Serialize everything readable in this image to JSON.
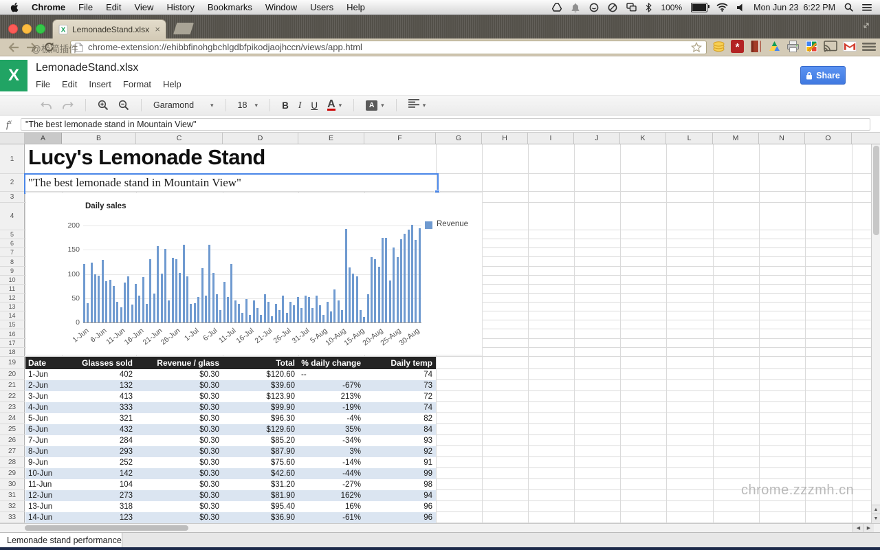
{
  "macbar": {
    "menus": [
      "Chrome",
      "File",
      "Edit",
      "View",
      "History",
      "Bookmarks",
      "Window",
      "Users",
      "Help"
    ],
    "status_icons": [
      "drive",
      "notifications",
      "app-circle",
      "do-not-disturb",
      "mirroring",
      "bluetooth"
    ],
    "battery_percent": "100%",
    "date": "Mon Jun 23",
    "time": "6:22 PM"
  },
  "browser": {
    "tab_title": "LemonadeStand.xlsx",
    "tab_close": "×",
    "url": "chrome-extension://ehibbfinohgbchlgdbfpikodjaojhccn/views/app.html",
    "toolbar_watermark": "@极简插件",
    "extension_icons": [
      "coins",
      "password",
      "book",
      "drive",
      "printer",
      "notes",
      "cast",
      "gmail",
      "menu"
    ]
  },
  "app": {
    "logo_letter": "X",
    "title": "LemonadeStand.xlsx",
    "menus": [
      "File",
      "Edit",
      "Insert",
      "Format",
      "Help"
    ],
    "share_label": "Share",
    "toolbar": {
      "font_name": "Garamond",
      "font_size": "18",
      "bold": "B",
      "italic": "I",
      "underline": "U",
      "text_color": "A",
      "fill_letter": "A"
    },
    "formula_prefix_f": "f",
    "formula_prefix_x": "x",
    "formula_value": "\"The best lemonade stand in Mountain View\""
  },
  "sheet": {
    "columns": [
      "A",
      "B",
      "C",
      "D",
      "E",
      "F",
      "G",
      "H",
      "I",
      "J",
      "K",
      "L",
      "M",
      "N",
      "O"
    ],
    "selected_column": "A",
    "row_numbers": [
      1,
      2,
      3,
      4,
      5,
      6,
      7,
      8,
      9,
      10,
      11,
      12,
      13,
      14,
      15,
      16,
      17,
      18,
      19,
      20,
      21,
      22,
      23,
      24,
      25,
      26,
      27,
      28,
      29,
      30,
      31,
      32,
      33
    ],
    "cells": {
      "a1": "Lucy's Lemonade Stand",
      "a2": "\"The best lemonade stand in Mountain View\""
    },
    "sheet_tab": "Lemonade stand performance",
    "page_watermark": "chrome.zzzmh.cn"
  },
  "table": {
    "headers": [
      "Date",
      "Glasses sold",
      "Revenue / glass",
      "Total",
      "% daily change",
      "Daily temp"
    ],
    "rows": [
      [
        "1-Jun",
        "402",
        "$0.30",
        "$120.60",
        "--",
        "74"
      ],
      [
        "2-Jun",
        "132",
        "$0.30",
        "$39.60",
        "-67%",
        "73"
      ],
      [
        "3-Jun",
        "413",
        "$0.30",
        "$123.90",
        "213%",
        "72"
      ],
      [
        "4-Jun",
        "333",
        "$0.30",
        "$99.90",
        "-19%",
        "74"
      ],
      [
        "5-Jun",
        "321",
        "$0.30",
        "$96.30",
        "-4%",
        "82"
      ],
      [
        "6-Jun",
        "432",
        "$0.30",
        "$129.60",
        "35%",
        "84"
      ],
      [
        "7-Jun",
        "284",
        "$0.30",
        "$85.20",
        "-34%",
        "93"
      ],
      [
        "8-Jun",
        "293",
        "$0.30",
        "$87.90",
        "3%",
        "92"
      ],
      [
        "9-Jun",
        "252",
        "$0.30",
        "$75.60",
        "-14%",
        "91"
      ],
      [
        "10-Jun",
        "142",
        "$0.30",
        "$42.60",
        "-44%",
        "99"
      ],
      [
        "11-Jun",
        "104",
        "$0.30",
        "$31.20",
        "-27%",
        "98"
      ],
      [
        "12-Jun",
        "273",
        "$0.30",
        "$81.90",
        "162%",
        "94"
      ],
      [
        "13-Jun",
        "318",
        "$0.30",
        "$95.40",
        "16%",
        "96"
      ],
      [
        "14-Jun",
        "123",
        "$0.30",
        "$36.90",
        "-61%",
        "96"
      ]
    ]
  },
  "chart_data": {
    "type": "bar",
    "title": "Daily sales",
    "legend": [
      {
        "name": "Revenue",
        "color": "#6f9ad0"
      }
    ],
    "legend_position": "right-top",
    "grid": true,
    "ylim": [
      0,
      200
    ],
    "y_ticks": [
      0,
      50,
      100,
      150,
      200
    ],
    "x_tick_labels": [
      "1-Jun",
      "6-Jun",
      "11-Jun",
      "16-Jun",
      "21-Jun",
      "26-Jun",
      "1-Jul",
      "6-Jul",
      "11-Jul",
      "16-Jul",
      "21-Jul",
      "26-Jul",
      "31-Jul",
      "5-Aug",
      "10-Aug",
      "15-Aug",
      "20-Aug",
      "25-Aug",
      "30-Aug"
    ],
    "x_tick_day_index": [
      0,
      5,
      10,
      15,
      20,
      25,
      30,
      35,
      40,
      45,
      50,
      55,
      60,
      65,
      70,
      75,
      80,
      85,
      90
    ],
    "series": [
      {
        "name": "Revenue",
        "values": [
          120.6,
          39.6,
          123.9,
          99.9,
          96.3,
          129.6,
          85.2,
          87.9,
          75.6,
          42.6,
          31.2,
          81.9,
          95.4,
          36.9,
          80,
          55,
          93,
          38,
          130,
          60,
          158,
          100,
          152,
          45,
          133,
          130,
          102,
          160,
          95,
          38,
          40,
          52,
          112,
          56,
          160,
          102,
          58,
          25,
          83,
          52,
          120,
          46,
          38,
          20,
          48,
          15,
          45,
          30,
          15,
          58,
          43,
          13,
          38,
          25,
          56,
          20,
          42,
          35,
          52,
          30,
          55,
          52,
          30,
          55,
          35,
          15,
          42,
          22,
          68,
          45,
          25,
          193,
          113,
          100,
          95,
          25,
          12,
          58,
          135,
          130,
          115,
          175,
          175,
          87,
          154,
          135,
          172,
          183,
          192,
          202,
          170,
          195
        ]
      }
    ],
    "colors": {
      "bar": "#6f9ad0",
      "band_row": "#dbe5f1",
      "table_header_bg": "#232323",
      "selection": "#4a86e8",
      "accent": "#4285f4"
    }
  }
}
